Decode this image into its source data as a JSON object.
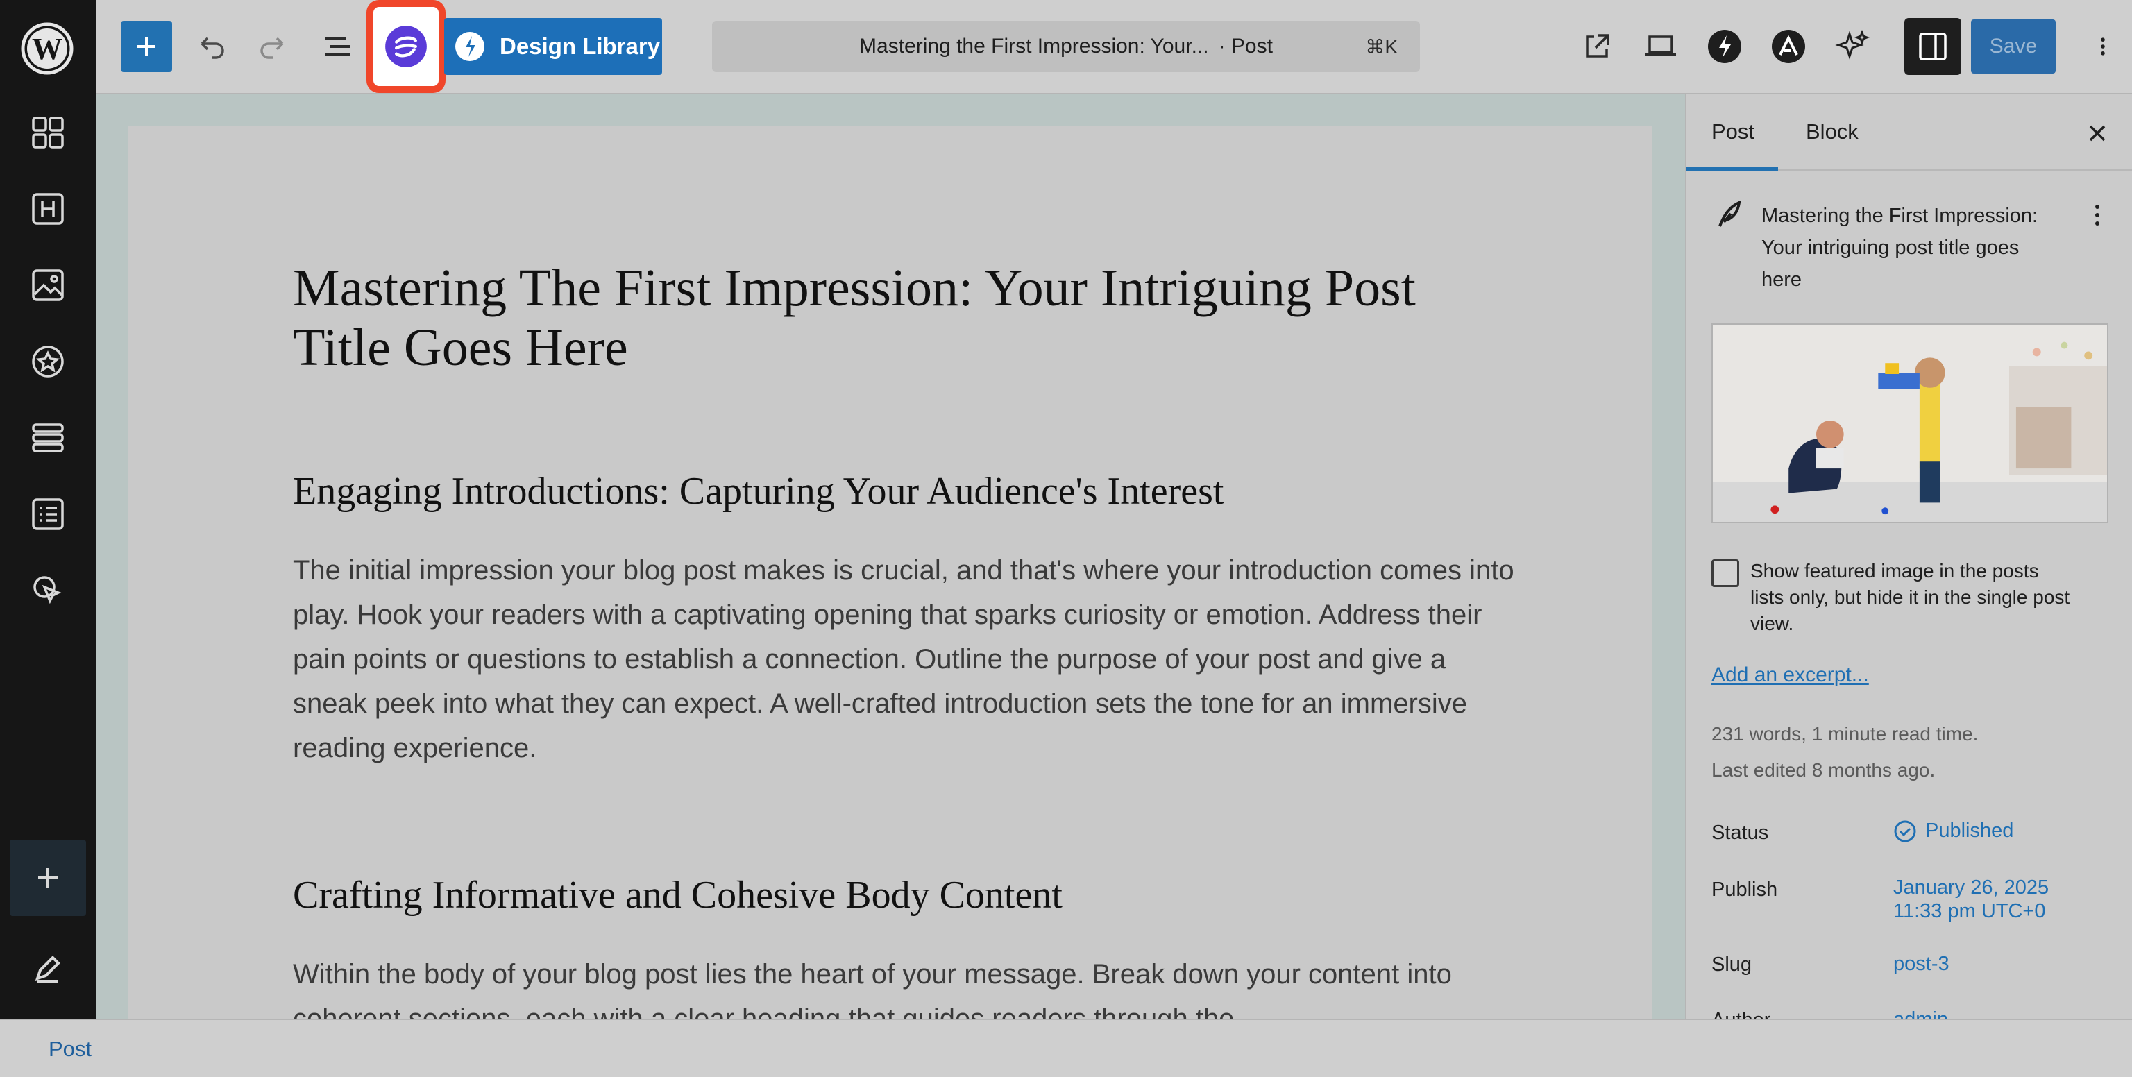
{
  "toolbar": {
    "design_library_label": "Design Library",
    "document_title": "Mastering the First Impression: Your...",
    "document_type": "· Post",
    "shortcut": "⌘K",
    "save_label": "Save"
  },
  "editor": {
    "title": "Mastering The First Impression: Your Intriguing Post Title Goes Here",
    "heading_1": "Engaging Introductions: Capturing Your Audience's Interest",
    "paragraph_1": "The initial impression your blog post makes is crucial, and that's where your introduction comes into play. Hook your readers with a captivating opening that sparks curiosity or emotion. Address their pain points or questions to establish a connection. Outline the purpose of your post and give a sneak peek into what they can expect. A well-crafted introduction sets the tone for an immersive reading experience.",
    "heading_2": "Crafting Informative and Cohesive Body Content",
    "paragraph_2": "Within the body of your blog post lies the heart of your message. Break down your content into coherent sections, each with a clear heading that guides readers through the"
  },
  "sidebar": {
    "tabs": [
      {
        "label": "Post",
        "active": true
      },
      {
        "label": "Block",
        "active": false
      }
    ],
    "post_summary_title": "Mastering the First Impression: Your intriguing post title goes here",
    "featured_checkbox_label": "Show featured image in the posts lists only, but hide it in the single post view.",
    "excerpt_link": "Add an excerpt...",
    "word_count": "231 words, 1 minute read time.",
    "last_edited": "Last edited 8 months ago.",
    "rows": {
      "status_label": "Status",
      "status_value": "Published",
      "publish_label": "Publish",
      "publish_date": "January 26, 2025",
      "publish_time": "11:33 pm UTC+0",
      "slug_label": "Slug",
      "slug_value": "post-3",
      "author_label": "Author",
      "author_value": "admin"
    }
  },
  "footer": {
    "breadcrumb": "Post"
  },
  "colors": {
    "accent": "#2271b1",
    "highlight": "#f0462a",
    "rail": "#161616"
  }
}
